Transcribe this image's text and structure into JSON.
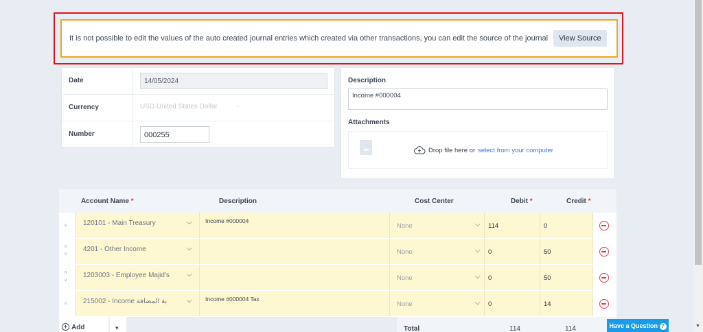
{
  "alert": {
    "message": "It is not possible to edit the values of the auto created journal entries which created via other transactions, you can edit the source of the journal",
    "button_label": "View Source"
  },
  "form": {
    "date_label": "Date",
    "date_value": "14/05/2024",
    "currency_label": "Currency",
    "currency_value": "USD United States Dollar",
    "currency_caret": "-",
    "number_label": "Number",
    "number_value": "000255",
    "description_label": "Description",
    "description_value": "Income #000004",
    "attachments_label": "Attachments",
    "drop_text": "Drop file here or",
    "drop_link": "select from your computer"
  },
  "table": {
    "headers": {
      "account": "Account Name",
      "description": "Description",
      "cost_center": "Cost Center",
      "debit": "Debit",
      "credit": "Credit",
      "required_mark": "*"
    },
    "rows": [
      {
        "arrows": "∨",
        "account": "120101 - Main Treasury",
        "description": "Income #000004",
        "cost_center": "None",
        "debit": "114",
        "credit": "0"
      },
      {
        "arrows": "∧\n∨",
        "account": "4201 - Other Income",
        "description": "",
        "cost_center": "None",
        "debit": "0",
        "credit": "50"
      },
      {
        "arrows": "∧\n∨",
        "account": "1203003 - Employee Majid's",
        "description": "",
        "cost_center": "None",
        "debit": "0",
        "credit": "50"
      },
      {
        "arrows": "∧",
        "account": "215002 - Income بة المضافة",
        "description": "Income #000004 Tax",
        "cost_center": "None",
        "debit": "0",
        "credit": "14"
      }
    ],
    "add_label": "Add",
    "total_label": "Total",
    "total_debit": "114",
    "total_credit": "114"
  },
  "help": {
    "label": "Have a Question",
    "icon": "?"
  },
  "icons": {
    "chevron": "⌵",
    "plus": "+",
    "caret": "▾",
    "upload": "upload-cloud-icon"
  },
  "colors": {
    "alert_outer": "#e3131b",
    "alert_inner": "#f0a623",
    "row_highlight": "#fdf8d2",
    "link": "#3778d9",
    "danger": "#e0394a",
    "help": "#1a9be8"
  }
}
